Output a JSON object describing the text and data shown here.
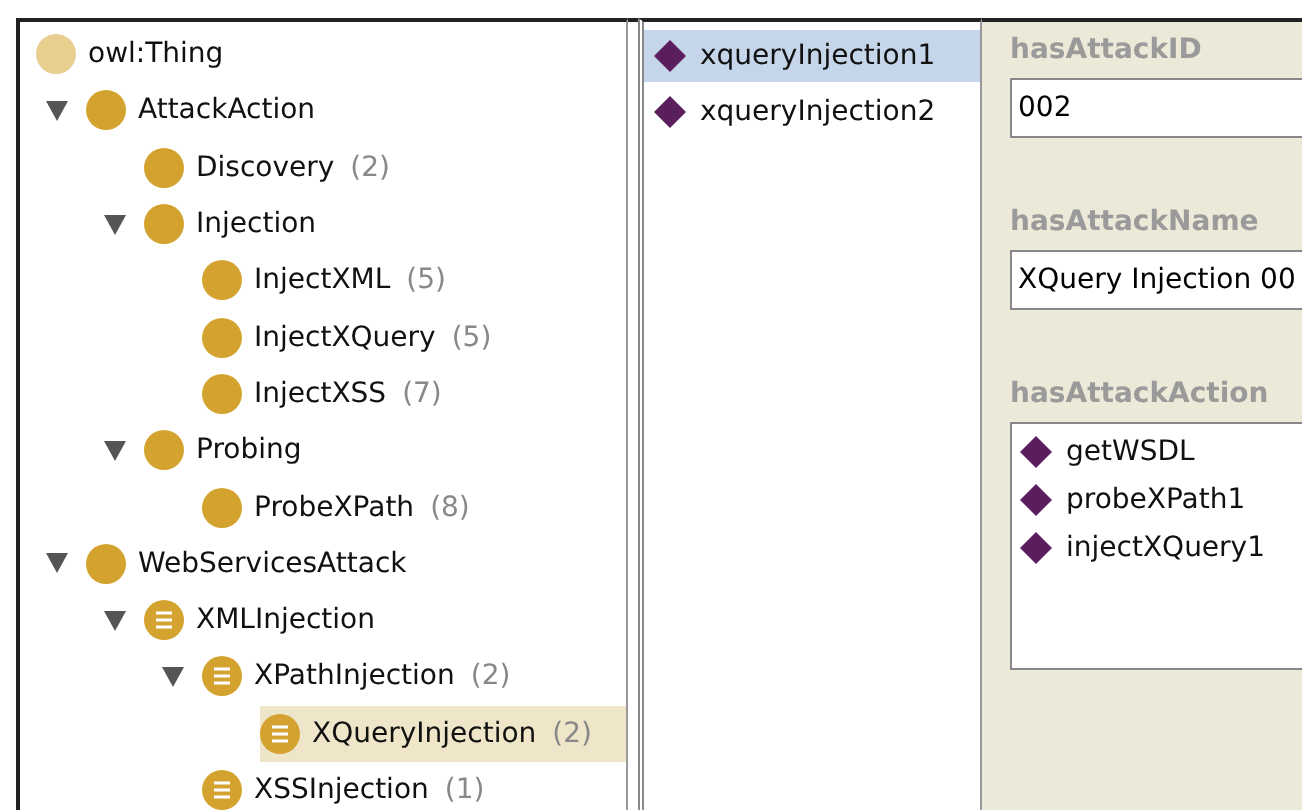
{
  "class_tree": {
    "label": "owl:Thing",
    "kind": "root",
    "children": [
      {
        "label": "AttackAction",
        "kind": "primitive",
        "expanded": true,
        "selected": false,
        "children": [
          {
            "label": "Discovery",
            "count": "(2)",
            "kind": "primitive",
            "selected": false
          },
          {
            "label": "Injection",
            "kind": "primitive",
            "expanded": true,
            "selected": false,
            "children": [
              {
                "label": "InjectXML",
                "count": "(5)",
                "kind": "primitive",
                "selected": false
              },
              {
                "label": "InjectXQuery",
                "count": "(5)",
                "kind": "primitive",
                "selected": false
              },
              {
                "label": "InjectXSS",
                "count": "(7)",
                "kind": "primitive",
                "selected": false
              }
            ]
          },
          {
            "label": "Probing",
            "kind": "primitive",
            "expanded": true,
            "selected": false,
            "children": [
              {
                "label": "ProbeXPath",
                "count": "(8)",
                "kind": "primitive",
                "selected": false
              }
            ]
          }
        ]
      },
      {
        "label": "WebServicesAttack",
        "kind": "primitive",
        "expanded": true,
        "selected": false,
        "children": [
          {
            "label": "XMLInjection",
            "kind": "defined",
            "expanded": true,
            "selected": false,
            "children": [
              {
                "label": "XPathInjection",
                "count": "(2)",
                "kind": "defined",
                "expanded": true,
                "selected": false,
                "children": [
                  {
                    "label": "XQueryInjection",
                    "count": "(2)",
                    "kind": "defined",
                    "selected": true
                  }
                ]
              },
              {
                "label": "XSSInjection",
                "count": "(1)",
                "kind": "defined",
                "selected": false
              }
            ]
          }
        ]
      }
    ]
  },
  "instances": [
    {
      "label": "xqueryInjection1",
      "selected": true
    },
    {
      "label": "xqueryInjection2",
      "selected": false
    }
  ],
  "properties": [
    {
      "name": "hasAttackID",
      "kind": "text",
      "value": "002"
    },
    {
      "name": "hasAttackName",
      "kind": "text",
      "value": "XQuery Injection 00"
    },
    {
      "name": "hasAttackAction",
      "kind": "list",
      "items": [
        "getWSDL",
        "probeXPath1",
        "injectXQuery1"
      ]
    }
  ]
}
